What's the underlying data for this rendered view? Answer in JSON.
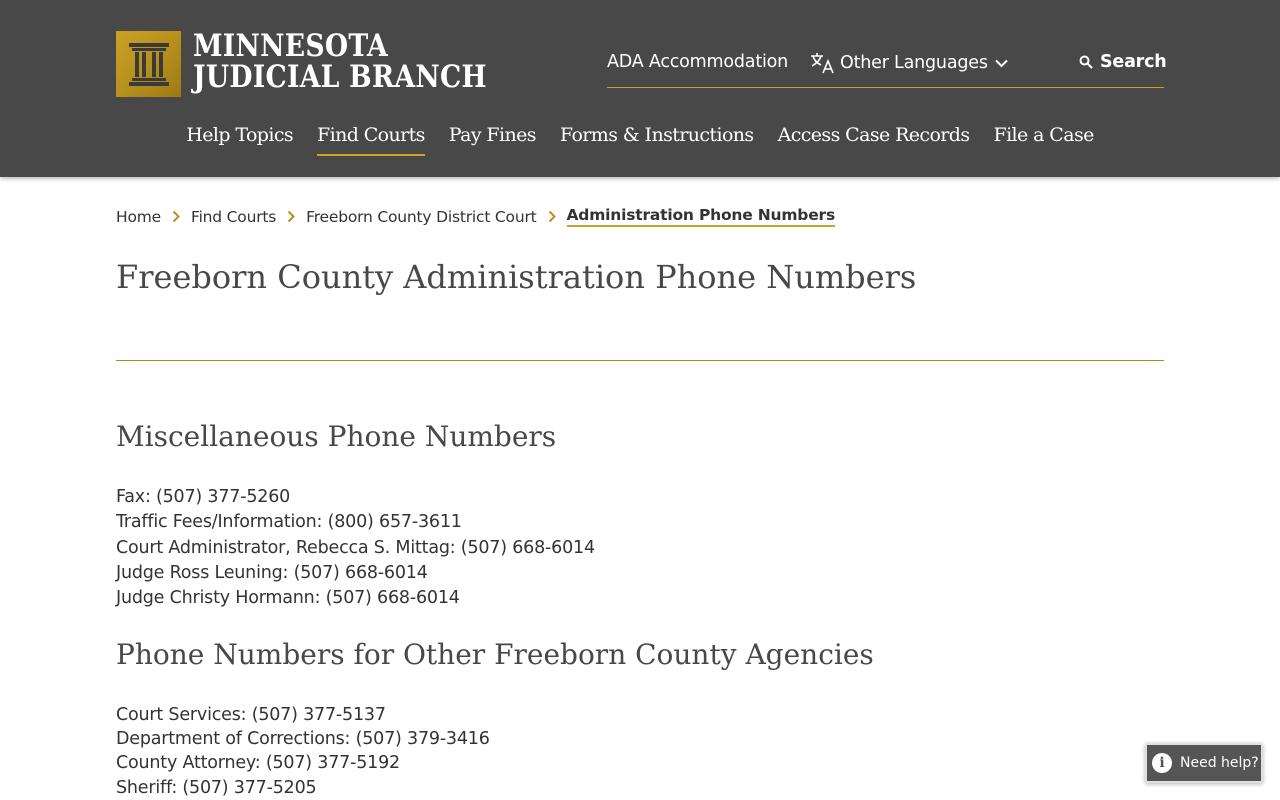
{
  "header": {
    "logo": {
      "line1": "MINNESOTA",
      "line2": "JUDICIAL BRANCH",
      "brand_color": "#c9a227"
    },
    "utility_nav": {
      "ada": "ADA Accommodation",
      "languages": "Other Languages",
      "search": "Search"
    },
    "main_nav": [
      {
        "label": "Help Topics",
        "active": false
      },
      {
        "label": "Find Courts",
        "active": true
      },
      {
        "label": "Pay Fines",
        "active": false
      },
      {
        "label": "Forms & Instructions",
        "active": false
      },
      {
        "label": "Access Case Records",
        "active": false
      },
      {
        "label": "File a Case",
        "active": false
      }
    ],
    "background_color": "#484848"
  },
  "breadcrumb": {
    "items": [
      "Home",
      "Find Courts",
      "Freeborn County District Court"
    ],
    "current": "Administration Phone Numbers"
  },
  "page_title": "Freeborn County Administration Phone Numbers",
  "sections": {
    "misc": {
      "heading": "Miscellaneous Phone Numbers",
      "items": [
        "Fax:  (507) 377-5260",
        "Traffic Fees/Information:  (800) 657-3611",
        "Court Administrator, Rebecca S. Mittag:  (507) 668-6014",
        "Judge Ross Leuning: (507) 668-6014",
        "Judge Christy Hormann: (507) 668-6014"
      ]
    },
    "other": {
      "heading": "Phone Numbers for Other Freeborn County Agencies",
      "items": [
        "Court Services:  (507) 377-5137",
        "Department of Corrections:  (507) 379-3416",
        "County Attorney:  (507) 377-5192",
        "Sheriff:  (507) 377-5205"
      ]
    }
  },
  "help_widget": {
    "label": "Need help?"
  }
}
